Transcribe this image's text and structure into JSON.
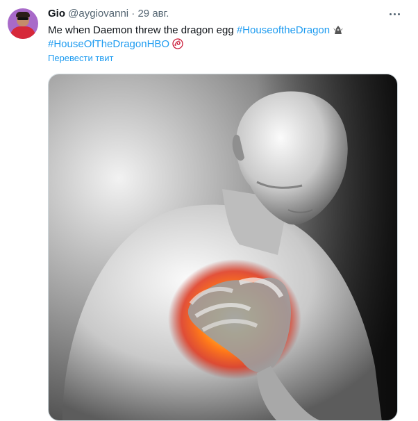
{
  "tweet": {
    "author": {
      "name": "Gio",
      "handle": "@aygiovanni",
      "separator": "·",
      "date": "29 авг."
    },
    "text": "Me when Daemon threw the dragon egg",
    "hashtags": [
      "#HouseoftheDragon",
      "#HouseOfTheDragonHBO"
    ],
    "translate_label": "Перевести твит",
    "emoji": [
      "dragon-crest-icon",
      "targaryen-sigil-icon"
    ]
  },
  "colors": {
    "link": "#1d9bf0",
    "secondary_text": "#536471",
    "primary_text": "#0f1419"
  }
}
